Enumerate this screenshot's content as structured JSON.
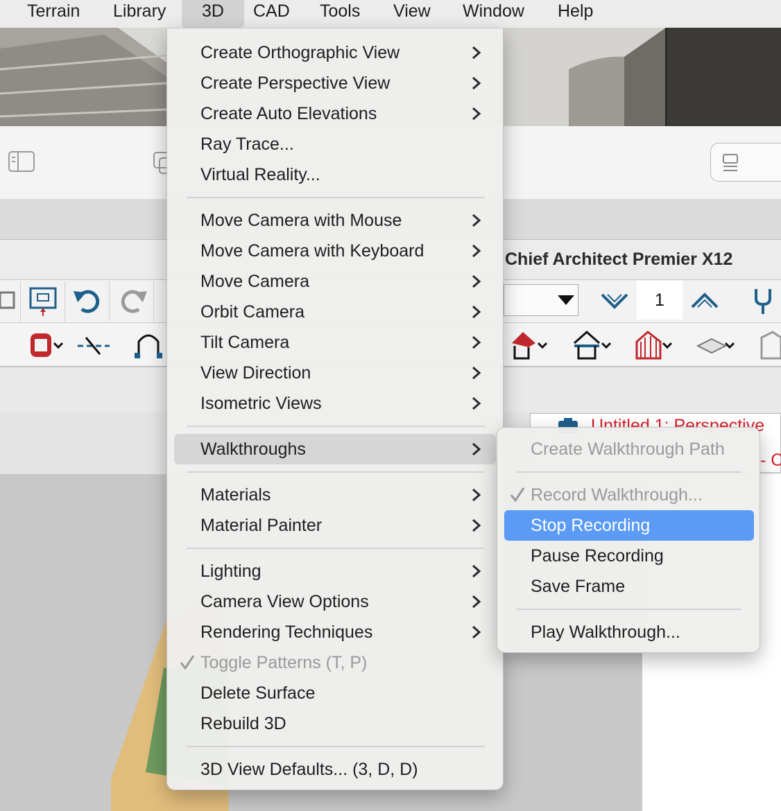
{
  "menubar": {
    "items": [
      {
        "label": "Terrain"
      },
      {
        "label": "Library"
      },
      {
        "label": "3D"
      },
      {
        "label": "CAD"
      },
      {
        "label": "Tools"
      },
      {
        "label": "View"
      },
      {
        "label": "Window"
      },
      {
        "label": "Help"
      }
    ],
    "active": "3D"
  },
  "app": {
    "title": "Chief Architect Premier X12",
    "level_number": "1",
    "tab_title": "Untitled 1: Perspective",
    "tab_title_suffix": "- C"
  },
  "menu_3d": {
    "items": [
      {
        "label": "Create Orthographic View",
        "submenu": true
      },
      {
        "label": "Create Perspective View",
        "submenu": true
      },
      {
        "label": "Create Auto Elevations",
        "submenu": true
      },
      {
        "label": "Ray Trace...",
        "submenu": false
      },
      {
        "label": "Virtual Reality...",
        "submenu": false
      },
      {
        "label": "Move Camera with Mouse",
        "submenu": true
      },
      {
        "label": "Move Camera with Keyboard",
        "submenu": true
      },
      {
        "label": "Move Camera",
        "submenu": true
      },
      {
        "label": "Orbit Camera",
        "submenu": true
      },
      {
        "label": "Tilt Camera",
        "submenu": true
      },
      {
        "label": "View Direction",
        "submenu": true
      },
      {
        "label": "Isometric Views",
        "submenu": true
      },
      {
        "label": "Walkthroughs",
        "submenu": true,
        "highlighted": true
      },
      {
        "label": "Materials",
        "submenu": true
      },
      {
        "label": "Material Painter",
        "submenu": true
      },
      {
        "label": "Lighting",
        "submenu": true
      },
      {
        "label": "Camera View Options",
        "submenu": true
      },
      {
        "label": "Rendering Techniques",
        "submenu": true
      },
      {
        "label": "Toggle Patterns (T, P)",
        "submenu": false,
        "checked": true,
        "disabled": true
      },
      {
        "label": "Delete Surface",
        "submenu": false
      },
      {
        "label": "Rebuild 3D",
        "submenu": false
      },
      {
        "label": "3D View Defaults... (3, D, D)",
        "submenu": false
      }
    ]
  },
  "menu_walkthroughs": {
    "items": [
      {
        "label": "Create Walkthrough Path",
        "disabled": true
      },
      {
        "label": "Record Walkthrough...",
        "disabled": true,
        "checked": true
      },
      {
        "label": "Stop Recording",
        "selected": true
      },
      {
        "label": "Pause Recording"
      },
      {
        "label": "Save Frame"
      },
      {
        "label": "Play Walkthrough..."
      }
    ]
  },
  "colors": {
    "selection": "#5b9bf5",
    "toolbar_blue": "#1f5f8b",
    "toolbar_red": "#c0282d",
    "tab_red": "#d8202a"
  },
  "icons": {
    "submenu_indicator": "chevron-right-icon",
    "checkmark": "checkmark-icon"
  }
}
